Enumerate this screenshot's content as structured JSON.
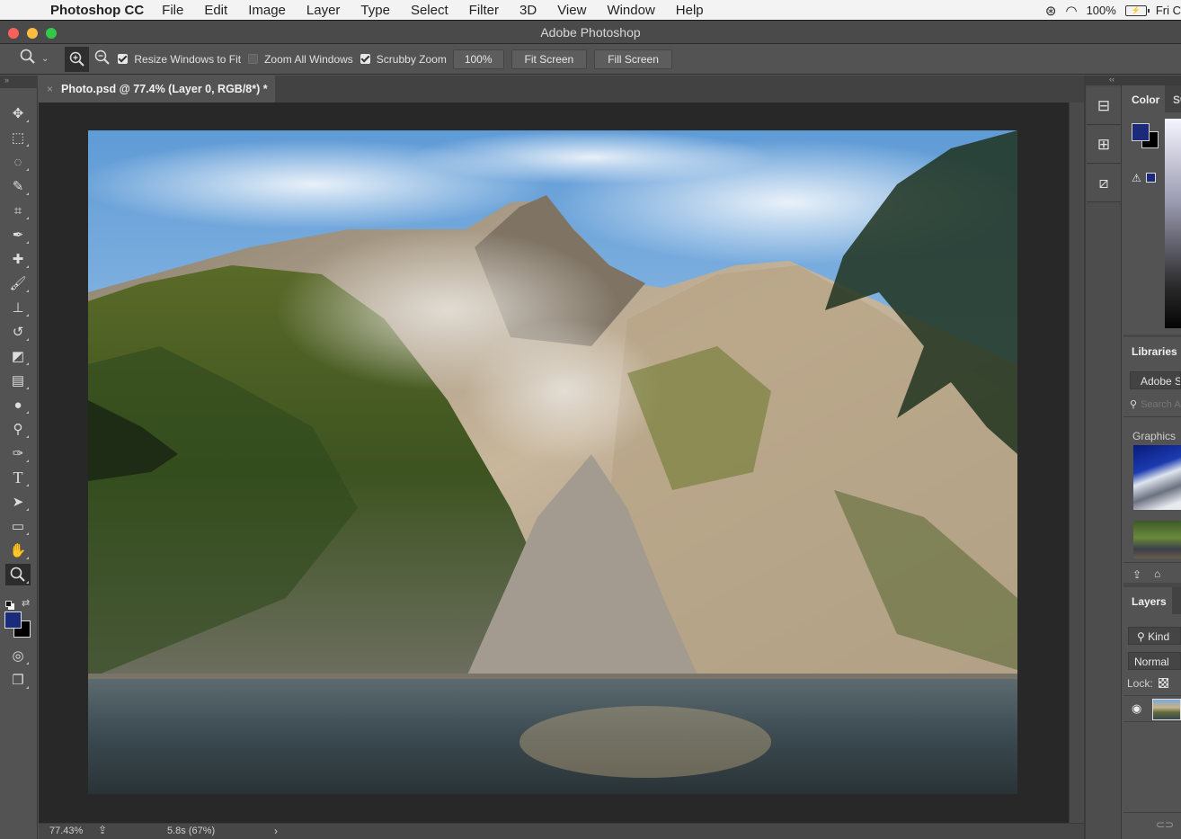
{
  "menubar": {
    "apple_icon": "apple-logo",
    "app_name": "Photoshop CC",
    "items": [
      "File",
      "Edit",
      "Image",
      "Layer",
      "Type",
      "Select",
      "Filter",
      "3D",
      "View",
      "Window",
      "Help"
    ],
    "status": {
      "cc_icon": "creative-cloud-icon",
      "wifi_icon": "wifi-icon",
      "battery_pct": "100%",
      "battery_icon": "battery-charging-icon",
      "clock": "Fri C"
    }
  },
  "window": {
    "title": "Adobe Photoshop",
    "traffic_lights": {
      "close": "#fc605b",
      "minimize": "#fdbc40",
      "zoom": "#34c84a"
    }
  },
  "options_bar": {
    "tool_preset_icon": "zoom-tool-icon",
    "zoom_in_icon": "zoom-in-icon",
    "zoom_out_icon": "zoom-out-icon",
    "checkboxes": [
      {
        "label": "Resize Windows to Fit",
        "checked": true
      },
      {
        "label": "Zoom All Windows",
        "checked": false
      },
      {
        "label": "Scrubby Zoom",
        "checked": true
      }
    ],
    "buttons": {
      "pct": "100%",
      "fit": "Fit Screen",
      "fill": "Fill Screen"
    }
  },
  "toolbar": {
    "collapse_glyph": "»",
    "tools": [
      {
        "name": "move-tool",
        "glyph": "✥"
      },
      {
        "name": "marquee-tool",
        "glyph": "⬚"
      },
      {
        "name": "lasso-tool",
        "glyph": "◌"
      },
      {
        "name": "quick-selection-tool",
        "glyph": "✎"
      },
      {
        "name": "crop-tool",
        "glyph": "⌗"
      },
      {
        "name": "eyedropper-tool",
        "glyph": "✒"
      },
      {
        "name": "healing-brush-tool",
        "glyph": "✚"
      },
      {
        "name": "brush-tool",
        "glyph": "🖌"
      },
      {
        "name": "clone-stamp-tool",
        "glyph": "⊥"
      },
      {
        "name": "history-brush-tool",
        "glyph": "↺"
      },
      {
        "name": "eraser-tool",
        "glyph": "◩"
      },
      {
        "name": "gradient-tool",
        "glyph": "▤"
      },
      {
        "name": "blur-tool",
        "glyph": "●"
      },
      {
        "name": "dodge-tool",
        "glyph": "⚲"
      },
      {
        "name": "pen-tool",
        "glyph": "✑"
      },
      {
        "name": "type-tool",
        "glyph": "T"
      },
      {
        "name": "path-selection-tool",
        "glyph": "➤"
      },
      {
        "name": "rectangle-tool",
        "glyph": "▭"
      },
      {
        "name": "hand-tool",
        "glyph": "✋"
      },
      {
        "name": "zoom-tool",
        "glyph": "🔍",
        "active": true
      }
    ],
    "swatches": {
      "foreground": "#1c2a7a",
      "background": "#000000",
      "swap_glyph": "⇄"
    },
    "quick_mask_glyph": "◎",
    "screen_mode_glyph": "❐"
  },
  "document": {
    "tab_title": "Photo.psd @ 77.4% (Layer 0, RGB/8*) *",
    "close_glyph": "×"
  },
  "statusbar": {
    "zoom": "77.43%",
    "export_glyph": "⇪",
    "timing": "5.8s (67%)",
    "arrow": "›"
  },
  "dock": {
    "collapse_glyph": "‹‹",
    "icons": [
      {
        "name": "history-panel-icon",
        "glyph": "⊟"
      },
      {
        "name": "properties-panel-icon",
        "glyph": "⊞"
      },
      {
        "name": "paths-panel-icon",
        "glyph": "⧄"
      }
    ]
  },
  "color_panel": {
    "tab": "Color",
    "tab2": "Sw",
    "foreground": "#1c2a7a",
    "background": "#000000",
    "gamut_warning_glyph": "⚠"
  },
  "libraries_panel": {
    "tab": "Libraries",
    "library_select": "Adobe Stock",
    "search_placeholder": "Search Adobe Stock",
    "search_glyph": "⚲",
    "section": "Graphics",
    "upload_glyph": "⇪",
    "cc_glyph": "⌂"
  },
  "layers_panel": {
    "tab": "Layers",
    "kind_filter": "⚲ Kind",
    "blend_mode": "Normal",
    "lock_label": "Lock:",
    "eye_glyph": "◉",
    "link_glyph": "⊂⊃"
  }
}
